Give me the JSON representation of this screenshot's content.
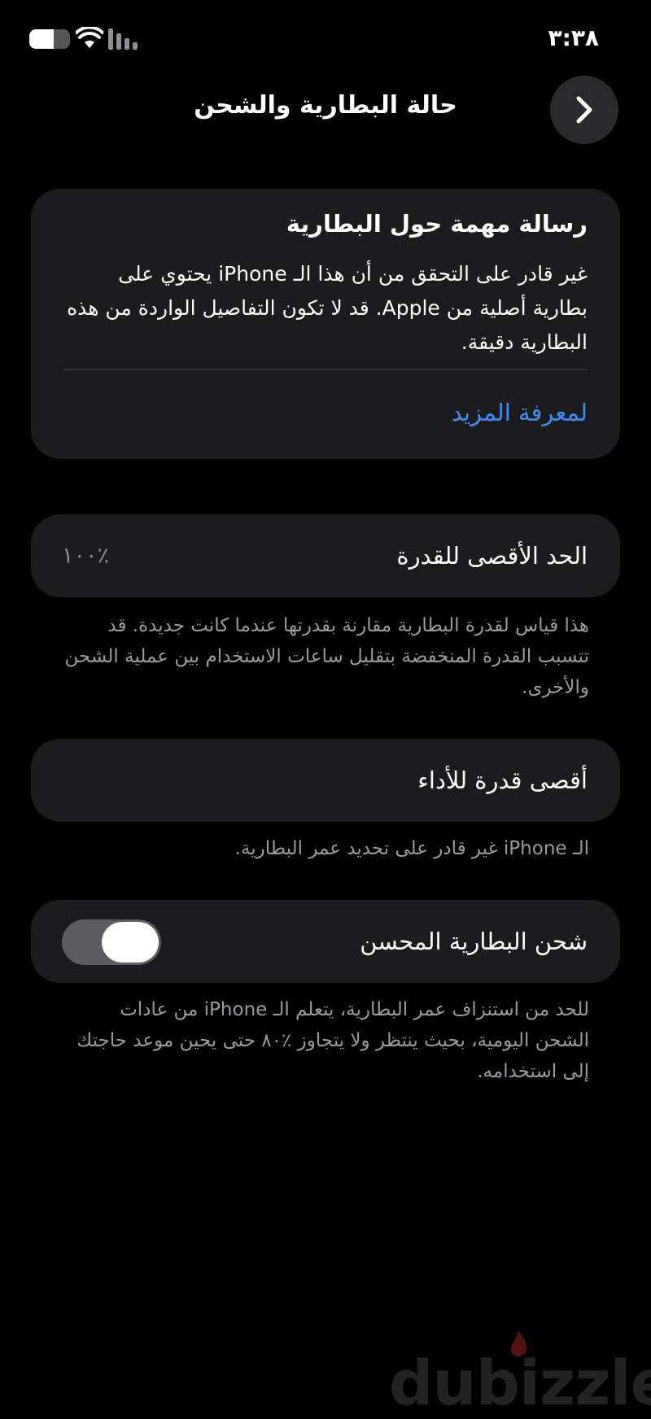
{
  "status_bar": {
    "time": "٣:٣٨",
    "battery_fraction": 0.6,
    "icons": [
      "battery-icon",
      "wifi-icon",
      "signal-icon"
    ]
  },
  "nav": {
    "title": "حالة البطارية والشحن",
    "back_icon": "chevron-right-icon"
  },
  "important_message": {
    "title": "رسالة مهمة حول البطارية",
    "body": "غير قادر على التحقق من أن هذا الـ iPhone يحتوي على بطارية أصلية من Apple. قد لا تكون التفاصيل الواردة من هذه البطارية دقيقة.",
    "link": "لمعرفة المزيد"
  },
  "maximum_capacity": {
    "label": "الحد الأقصى للقدرة",
    "value": "٪١٠٠",
    "footnote": "هذا قياس لقدرة البطارية مقارنة بقدرتها عندما كانت جديدة. قد تتسبب القدرة المنخفضة بتقليل ساعات الاستخدام بين عملية الشحن والأخرى."
  },
  "peak_performance": {
    "label": "أقصى قدرة للأداء",
    "footnote": "الـ iPhone غير قادر على تحديد عمر البطارية."
  },
  "optimized_charging": {
    "label": "شحن البطارية المحسن",
    "enabled": true,
    "footnote": "للحد من استنزاف عمر البطارية، يتعلم الـ iPhone من عادات الشحن اليومية، بحيث ينتظر ولا يتجاوز ٪٨٠ حتى يحين موعد حاجتك إلى استخدامه."
  },
  "watermark": "dubizzle",
  "colors": {
    "background": "#000000",
    "card": "#1c1c1e",
    "link": "#3a8ff5",
    "secondary_text": "#9a9aa0"
  }
}
